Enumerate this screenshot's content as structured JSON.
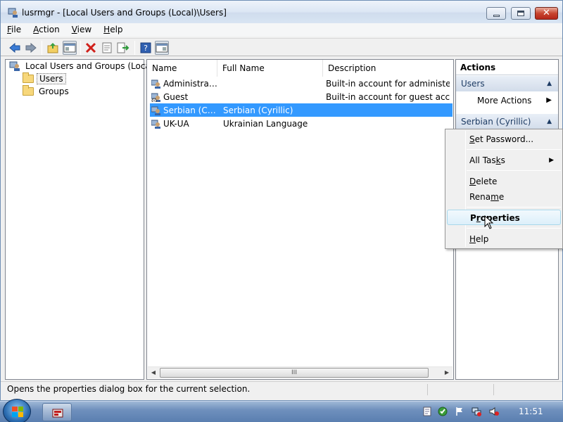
{
  "window": {
    "title": "lusrmgr - [Local Users and Groups (Local)\\Users]"
  },
  "menubar": [
    {
      "pre": "",
      "key": "F",
      "post": "ile"
    },
    {
      "pre": "",
      "key": "A",
      "post": "ction"
    },
    {
      "pre": "",
      "key": "V",
      "post": "iew"
    },
    {
      "pre": "",
      "key": "H",
      "post": "elp"
    }
  ],
  "toolbar_icons": [
    "back-arrow-icon",
    "forward-arrow-icon",
    "up-folder-icon",
    "show-hide-tree-icon",
    "delete-icon",
    "properties-icon",
    "export-list-icon",
    "help-icon",
    "show-hide-action-pane-icon"
  ],
  "tree": {
    "root": "Local Users and Groups (Local)",
    "children": [
      "Users",
      "Groups"
    ]
  },
  "list": {
    "columns": [
      "Name",
      "Full Name",
      "Description"
    ],
    "rows": [
      {
        "name": "Administrator",
        "full_name": "",
        "description": "Built-in account for administering"
      },
      {
        "name": "Guest",
        "full_name": "",
        "description": "Built-in account for guest access t"
      },
      {
        "name": "Serbian (Cyri...",
        "full_name": "Serbian (Cyrillic)",
        "description": ""
      },
      {
        "name": "UK-UA",
        "full_name": "Ukrainian Language",
        "description": ""
      }
    ],
    "selected_index": 2,
    "scroll_thumb_grip": "III"
  },
  "actions": {
    "title": "Actions",
    "group1": "Users",
    "more_actions": "More Actions",
    "group2": "Serbian (Cyrillic)"
  },
  "context_menu": {
    "items": [
      {
        "pre": "",
        "key": "S",
        "post": "et Password..."
      },
      {
        "pre": "All Tas",
        "key": "k",
        "post": "s"
      },
      {
        "pre": "",
        "key": "D",
        "post": "elete"
      },
      {
        "pre": "Rena",
        "key": "m",
        "post": "e"
      },
      {
        "pre": "P",
        "key": "r",
        "post": "operties"
      },
      {
        "pre": "",
        "key": "H",
        "post": "elp"
      }
    ],
    "highlighted": "Properties"
  },
  "statusbar": {
    "text": "Opens the properties dialog box for the current selection."
  },
  "taskbar": {
    "clock": "11:51"
  },
  "colors": {
    "selection": "#3399ff",
    "titlebar": "#dbe6f4",
    "taskbar": "#6f90bd"
  }
}
